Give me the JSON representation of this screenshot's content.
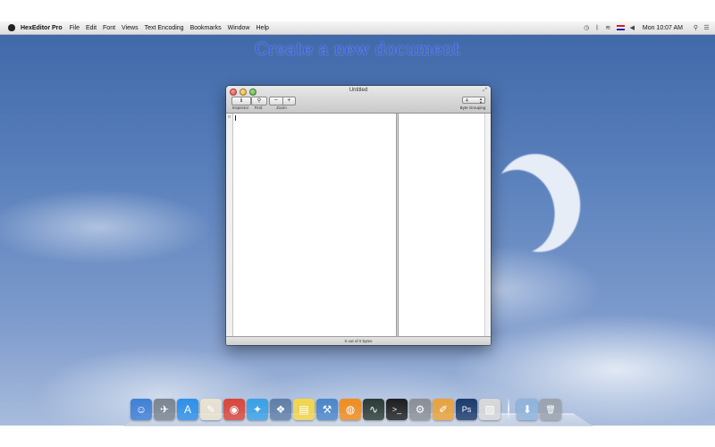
{
  "menubar": {
    "app_name": "HexEditor Pro",
    "menus": [
      "File",
      "Edit",
      "Font",
      "Views",
      "Text Encoding",
      "Bookmarks",
      "Window",
      "Help"
    ],
    "clock": "Mon 10:07 AM",
    "status_icons": [
      "time-machine-icon",
      "bluetooth-icon",
      "wifi-icon",
      "flag-icon",
      "volume-icon"
    ]
  },
  "desktop": {
    "headline": "Create a new document"
  },
  "window": {
    "title": "Untitled",
    "toolbar": {
      "inspector_label": "Inspector",
      "find_label": "Find",
      "zoom_label": "Zoom",
      "zoom_out": "−",
      "zoom_in": "+",
      "byte_grouping_value": "4",
      "byte_grouping_label": "Byte Grouping"
    },
    "gutter_offset": "0",
    "status_text": "0 out of 0 bytes"
  },
  "dock": {
    "icons": [
      {
        "name": "finder-icon",
        "glyph": "☺",
        "color": "#3f7fd6"
      },
      {
        "name": "launchpad-icon",
        "glyph": "✈",
        "color": "#7b8491"
      },
      {
        "name": "app-store-icon",
        "glyph": "A",
        "color": "#2d8fe8"
      },
      {
        "name": "textedit-icon",
        "glyph": "✎",
        "color": "#e8e2cf"
      },
      {
        "name": "chrome-icon",
        "glyph": "◉",
        "color": "#d9463b"
      },
      {
        "name": "safari-icon",
        "glyph": "✦",
        "color": "#3aa0e6"
      },
      {
        "name": "preview-icon",
        "glyph": "❖",
        "color": "#5f7fa8"
      },
      {
        "name": "stickies-icon",
        "glyph": "▤",
        "color": "#f2d64b"
      },
      {
        "name": "xcode-icon",
        "glyph": "⚒",
        "color": "#4b86c9"
      },
      {
        "name": "ibooks-icon",
        "glyph": "◍",
        "color": "#f08c1f"
      },
      {
        "name": "activity-monitor-icon",
        "glyph": "∿",
        "color": "#2b3a33"
      },
      {
        "name": "terminal-icon",
        "glyph": ">_",
        "color": "#1e1e1e"
      },
      {
        "name": "system-preferences-icon",
        "glyph": "⚙",
        "color": "#8a8f96"
      },
      {
        "name": "pages-icon",
        "glyph": "✐",
        "color": "#e9a23b"
      },
      {
        "name": "photoshop-icon",
        "glyph": "Ps",
        "color": "#1c3a6b"
      },
      {
        "name": "pdf-document-icon",
        "glyph": "▧",
        "color": "#d8d8d8"
      }
    ],
    "stack_icons": [
      {
        "name": "downloads-folder-icon",
        "glyph": "⬇",
        "color": "#8fb4dc"
      },
      {
        "name": "trash-icon",
        "glyph": "🗑",
        "color": "#9aa3ad"
      }
    ]
  }
}
